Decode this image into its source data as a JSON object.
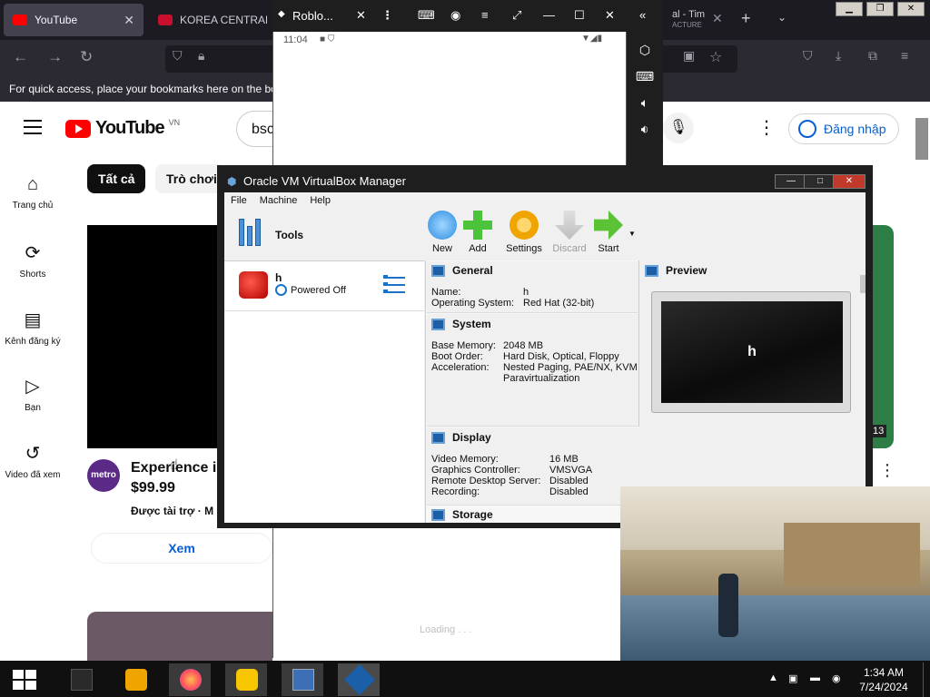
{
  "browser": {
    "tabs": [
      {
        "title": "YouTube",
        "active": true
      },
      {
        "title": "KOREA CENTRAL T",
        "active": false
      },
      {
        "title": "al - Tim",
        "subtitle": "ACTURE",
        "active": false
      }
    ],
    "bookmark_hint": "For quick access, place your bookmarks here on the bo",
    "accent": "#ff0000"
  },
  "youtube": {
    "logo_text": "YouTube",
    "region": "VN",
    "search_value": "bsc",
    "signin_label": "Đăng nhập",
    "sidebar": [
      {
        "label": "Trang chủ",
        "icon": "home-icon"
      },
      {
        "label": "Shorts",
        "icon": "shorts-icon"
      },
      {
        "label": "Kênh đăng ký",
        "icon": "subscriptions-icon"
      },
      {
        "label": "Bạn",
        "icon": "you-icon"
      },
      {
        "label": "Video đã xem",
        "icon": "history-icon"
      }
    ],
    "chips": [
      "Tất cả",
      "Trò chơi"
    ],
    "ad": {
      "channel_logo": "metro",
      "title": "Experience iP",
      "price": "$99.99",
      "sponsored": "Được tài trợ · M",
      "button": "Xem"
    },
    "duration_badge": "13"
  },
  "emulator": {
    "title": "Roblo...",
    "clock": "11:04",
    "loading_text": "Loading . . ."
  },
  "virtualbox": {
    "title": "Oracle VM VirtualBox Manager",
    "menu": [
      "File",
      "Machine",
      "Help"
    ],
    "tools_label": "Tools",
    "toolbar": [
      {
        "label": "New",
        "enabled": true
      },
      {
        "label": "Add",
        "enabled": true
      },
      {
        "label": "Settings",
        "enabled": true
      },
      {
        "label": "Discard",
        "enabled": false
      },
      {
        "label": "Start",
        "enabled": true
      }
    ],
    "vm": {
      "name": "h",
      "state": "Powered Off"
    },
    "general": {
      "heading": "General",
      "name_label": "Name:",
      "name_value": "h",
      "os_label": "Operating System:",
      "os_value": "Red Hat (32-bit)"
    },
    "system": {
      "heading": "System",
      "memory_label": "Base Memory:",
      "memory_value": "2048 MB",
      "boot_label": "Boot Order:",
      "boot_value": "Hard Disk, Optical, Floppy",
      "accel_label": "Acceleration:",
      "accel_value": "Nested Paging, PAE/NX, KVM",
      "accel_value2": "Paravirtualization"
    },
    "display": {
      "heading": "Display",
      "vmem_label": "Video Memory:",
      "vmem_value": "16 MB",
      "gc_label": "Graphics Controller:",
      "gc_value": "VMSVGA",
      "rds_label": "Remote Desktop Server:",
      "rds_value": "Disabled",
      "rec_label": "Recording:",
      "rec_value": "Disabled"
    },
    "storage_heading": "Storage",
    "preview_heading": "Preview",
    "preview_text": "h"
  },
  "taskbar": {
    "time": "1:34 AM",
    "date": "7/24/2024"
  }
}
